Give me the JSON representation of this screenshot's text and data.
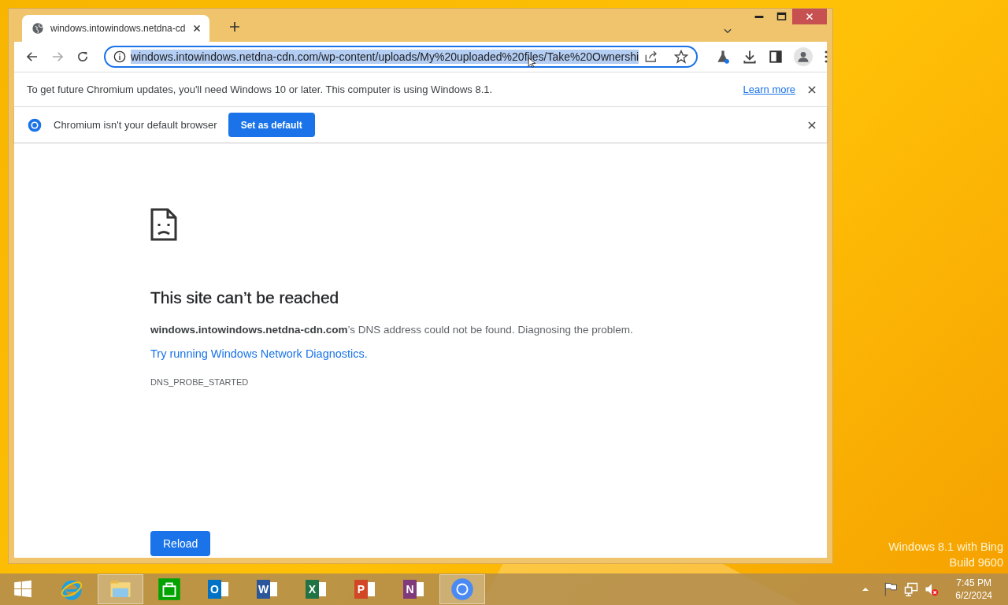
{
  "browser": {
    "tabs": [
      {
        "title": "windows.intowindows.netdna-cd",
        "selected": true
      }
    ],
    "address_bar": {
      "url": "windows.intowindows.netdna-cdn.com/wp-content/uploads/My%20uploaded%20files/Take%20Ownershi",
      "text_selected": true
    }
  },
  "infobars": [
    {
      "kind": "notice",
      "text": "To get future Chromium updates, you'll need Windows 10 or later. This computer is using Windows 8.1.",
      "link": "Learn more"
    },
    {
      "kind": "default_browser",
      "text": "Chromium isn't your default browser",
      "button": "Set as default"
    }
  ],
  "error_page": {
    "title": "This site can’t be reached",
    "message": "**windows.intowindows.netdna-cdn.com**’s DNS address could not be found. Diagnosing the problem.",
    "link": "Try running Windows Network Diagnostics.",
    "code": "DNS_PROBE_STARTED",
    "button": "Reload"
  },
  "desktop_watermark": [
    "Windows 8.1 with Bing",
    "Build 9600"
  ],
  "taskbar": {
    "items": [
      {
        "kind": "start",
        "selected": false
      },
      {
        "kind": "ie",
        "selected": false
      },
      {
        "kind": "explorer",
        "selected": true
      },
      {
        "kind": "store",
        "selected": false
      },
      {
        "kind": "office",
        "letter": "O",
        "color": "#0072c6",
        "selected": false
      },
      {
        "kind": "office",
        "letter": "W",
        "color": "#2b579a",
        "selected": false
      },
      {
        "kind": "office",
        "letter": "X",
        "color": "#217346",
        "selected": false
      },
      {
        "kind": "office",
        "letter": "P",
        "color": "#d24726",
        "selected": false
      },
      {
        "kind": "office",
        "letter": "N",
        "color": "#80397b",
        "selected": false
      },
      {
        "kind": "chromium",
        "selected": true
      }
    ],
    "clock": {
      "time": "7:45 PM",
      "date": "6/2/2024"
    }
  }
}
